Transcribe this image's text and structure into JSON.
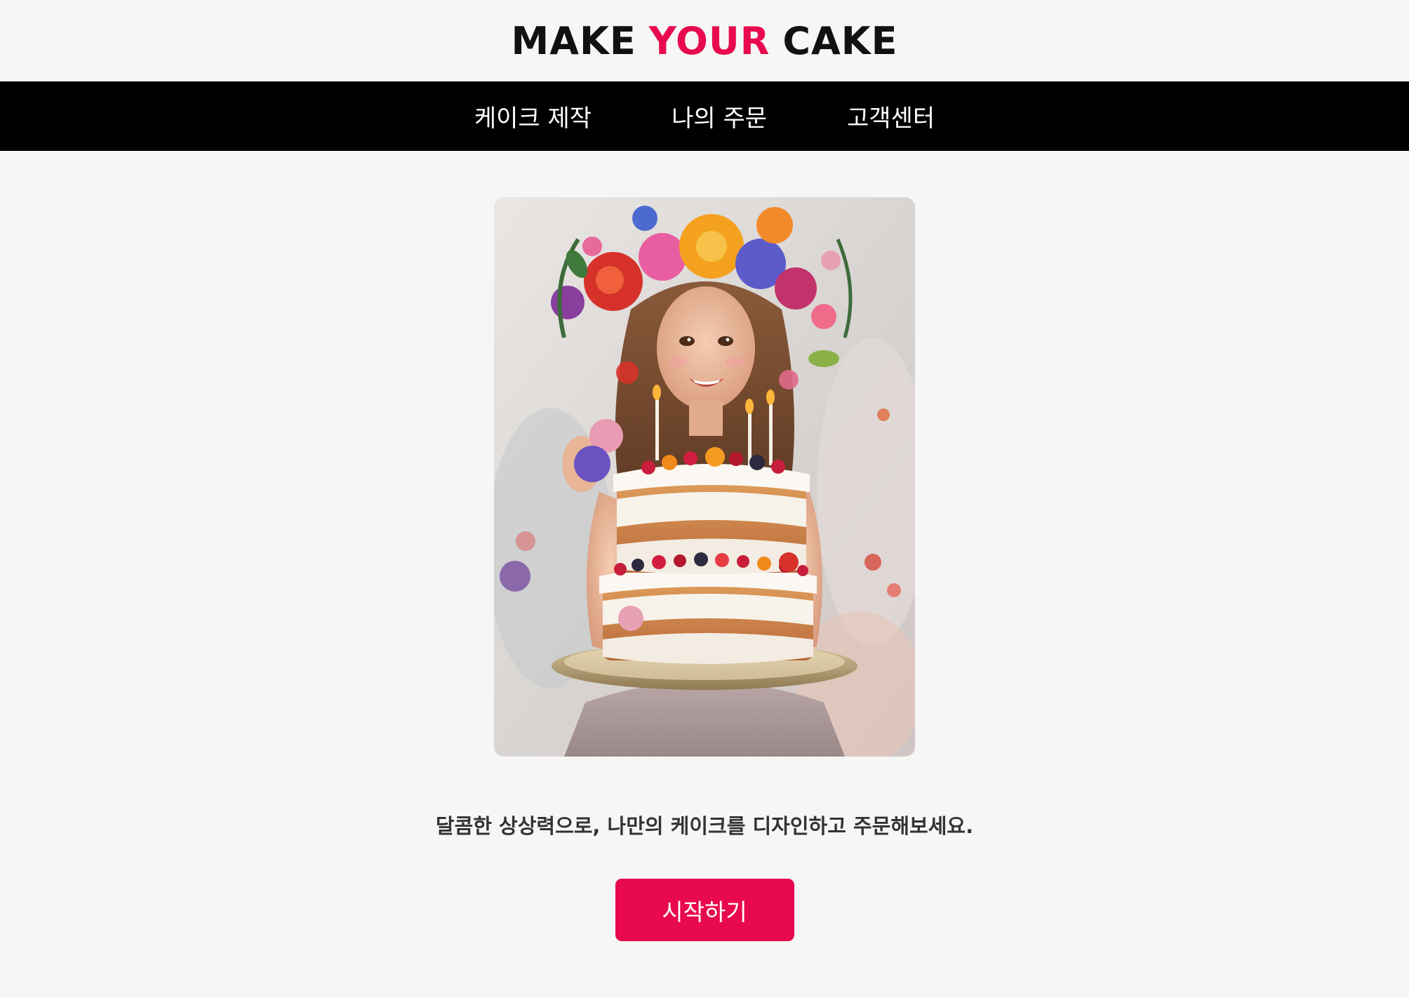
{
  "brand": {
    "part1": "MAKE",
    "part2": "YOUR",
    "part3": "CAKE",
    "accent_color": "#e8094f"
  },
  "nav": {
    "items": [
      {
        "label": "케이크 제작"
      },
      {
        "label": "나의 주문"
      },
      {
        "label": "고객센터"
      }
    ]
  },
  "hero": {
    "image": "girl-holding-layered-cake-with-flower-crown-illustration"
  },
  "tagline": "달콤한 상상력으로, 나만의 케이크를 디자인하고 주문해보세요.",
  "cta": {
    "label": "시작하기",
    "color": "#e8094f"
  }
}
